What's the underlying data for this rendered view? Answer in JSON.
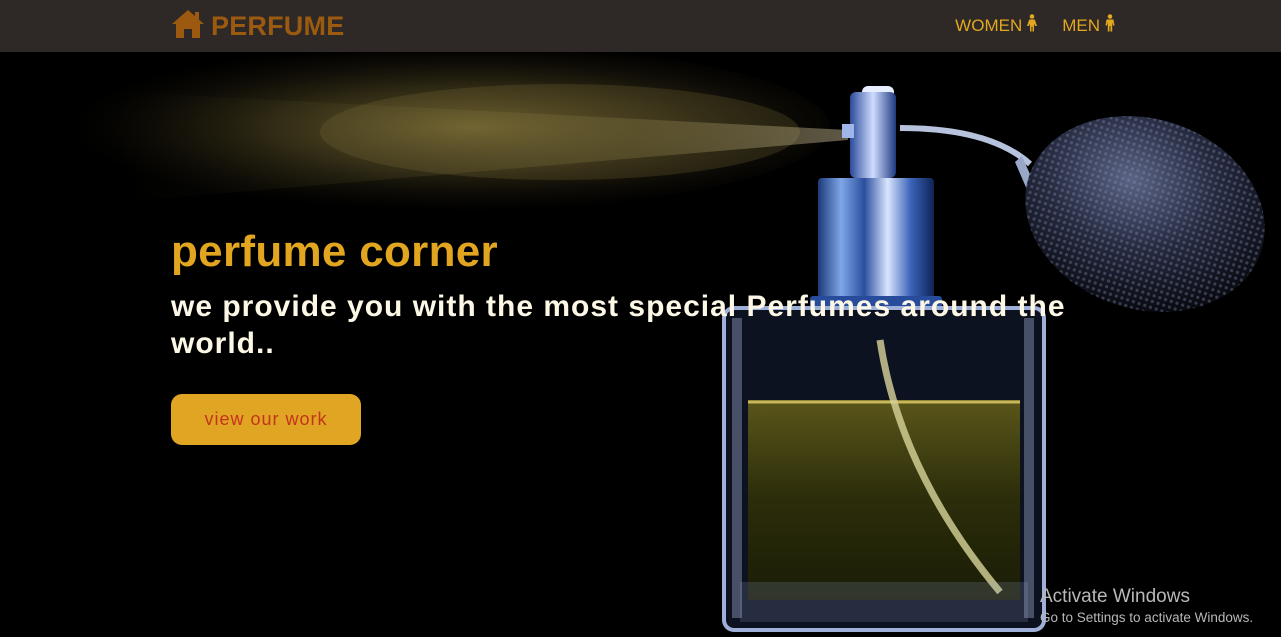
{
  "nav": {
    "brand_icon": "home-icon",
    "brand_label": "PERFUME",
    "links": [
      {
        "label": "WOMEN",
        "icon": "female-icon"
      },
      {
        "label": "MEN",
        "icon": "male-icon"
      }
    ]
  },
  "hero": {
    "headline": "perfume corner",
    "tagline": "we provide you with the most special Perfumes around the world..",
    "cta_label": "view our work",
    "image": "perfume-bottle-spray-image"
  },
  "watermark": {
    "title": "Activate Windows",
    "subtitle": "Go to Settings to activate Windows."
  },
  "colors": {
    "navbar_bg": "#2e2826",
    "brand": "#9c5a10",
    "accent": "#e2a520",
    "cta_text": "#c4331b",
    "tagline": "#fdf7e6"
  }
}
